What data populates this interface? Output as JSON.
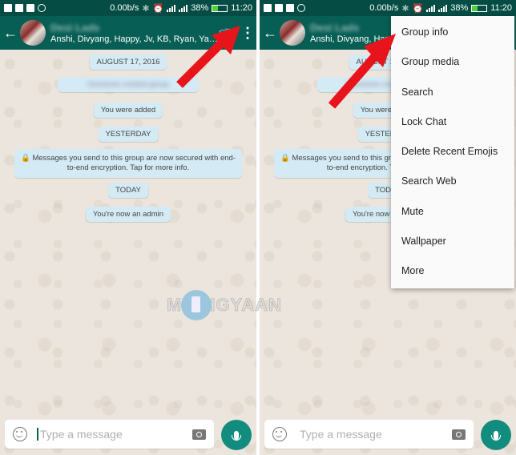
{
  "status_bar": {
    "network_speed": "0.00b/s",
    "network_type": "4G",
    "battery_percent": "38%",
    "battery_level": 0.38,
    "time": "11:20"
  },
  "app_bar": {
    "group_name": "Desi Lads",
    "members": "Anshi, Divyang, Happy, Jv, KB, Ryan, Yash,..."
  },
  "chat": {
    "messages": [
      {
        "type": "date",
        "text": "AUGUST 17, 2016"
      },
      {
        "type": "system-blurred",
        "text": "Someone created group"
      },
      {
        "type": "system",
        "text": "You were added"
      },
      {
        "type": "date",
        "text": "YESTERDAY"
      },
      {
        "type": "system",
        "text": "Messages you send to this group are now secured with end-to-end encryption. Tap for more info."
      },
      {
        "type": "date",
        "text": "TODAY"
      },
      {
        "type": "system",
        "text": "You're now an admin"
      }
    ]
  },
  "input": {
    "placeholder": "Type a message",
    "value": ""
  },
  "overflow_menu": {
    "items": [
      {
        "label": "Group info"
      },
      {
        "label": "Group media"
      },
      {
        "label": "Search"
      },
      {
        "label": "Lock Chat"
      },
      {
        "label": "Delete Recent Emojis"
      },
      {
        "label": "Search Web"
      },
      {
        "label": "Mute"
      },
      {
        "label": "Wallpaper"
      },
      {
        "label": "More"
      }
    ]
  },
  "watermark": "MOBIGYAAN",
  "colors": {
    "header": "#075e54",
    "statusbar": "#054d44",
    "accent": "#128c7e",
    "system_bubble": "#d4eaf4",
    "annotation_arrow": "#e8141b"
  }
}
